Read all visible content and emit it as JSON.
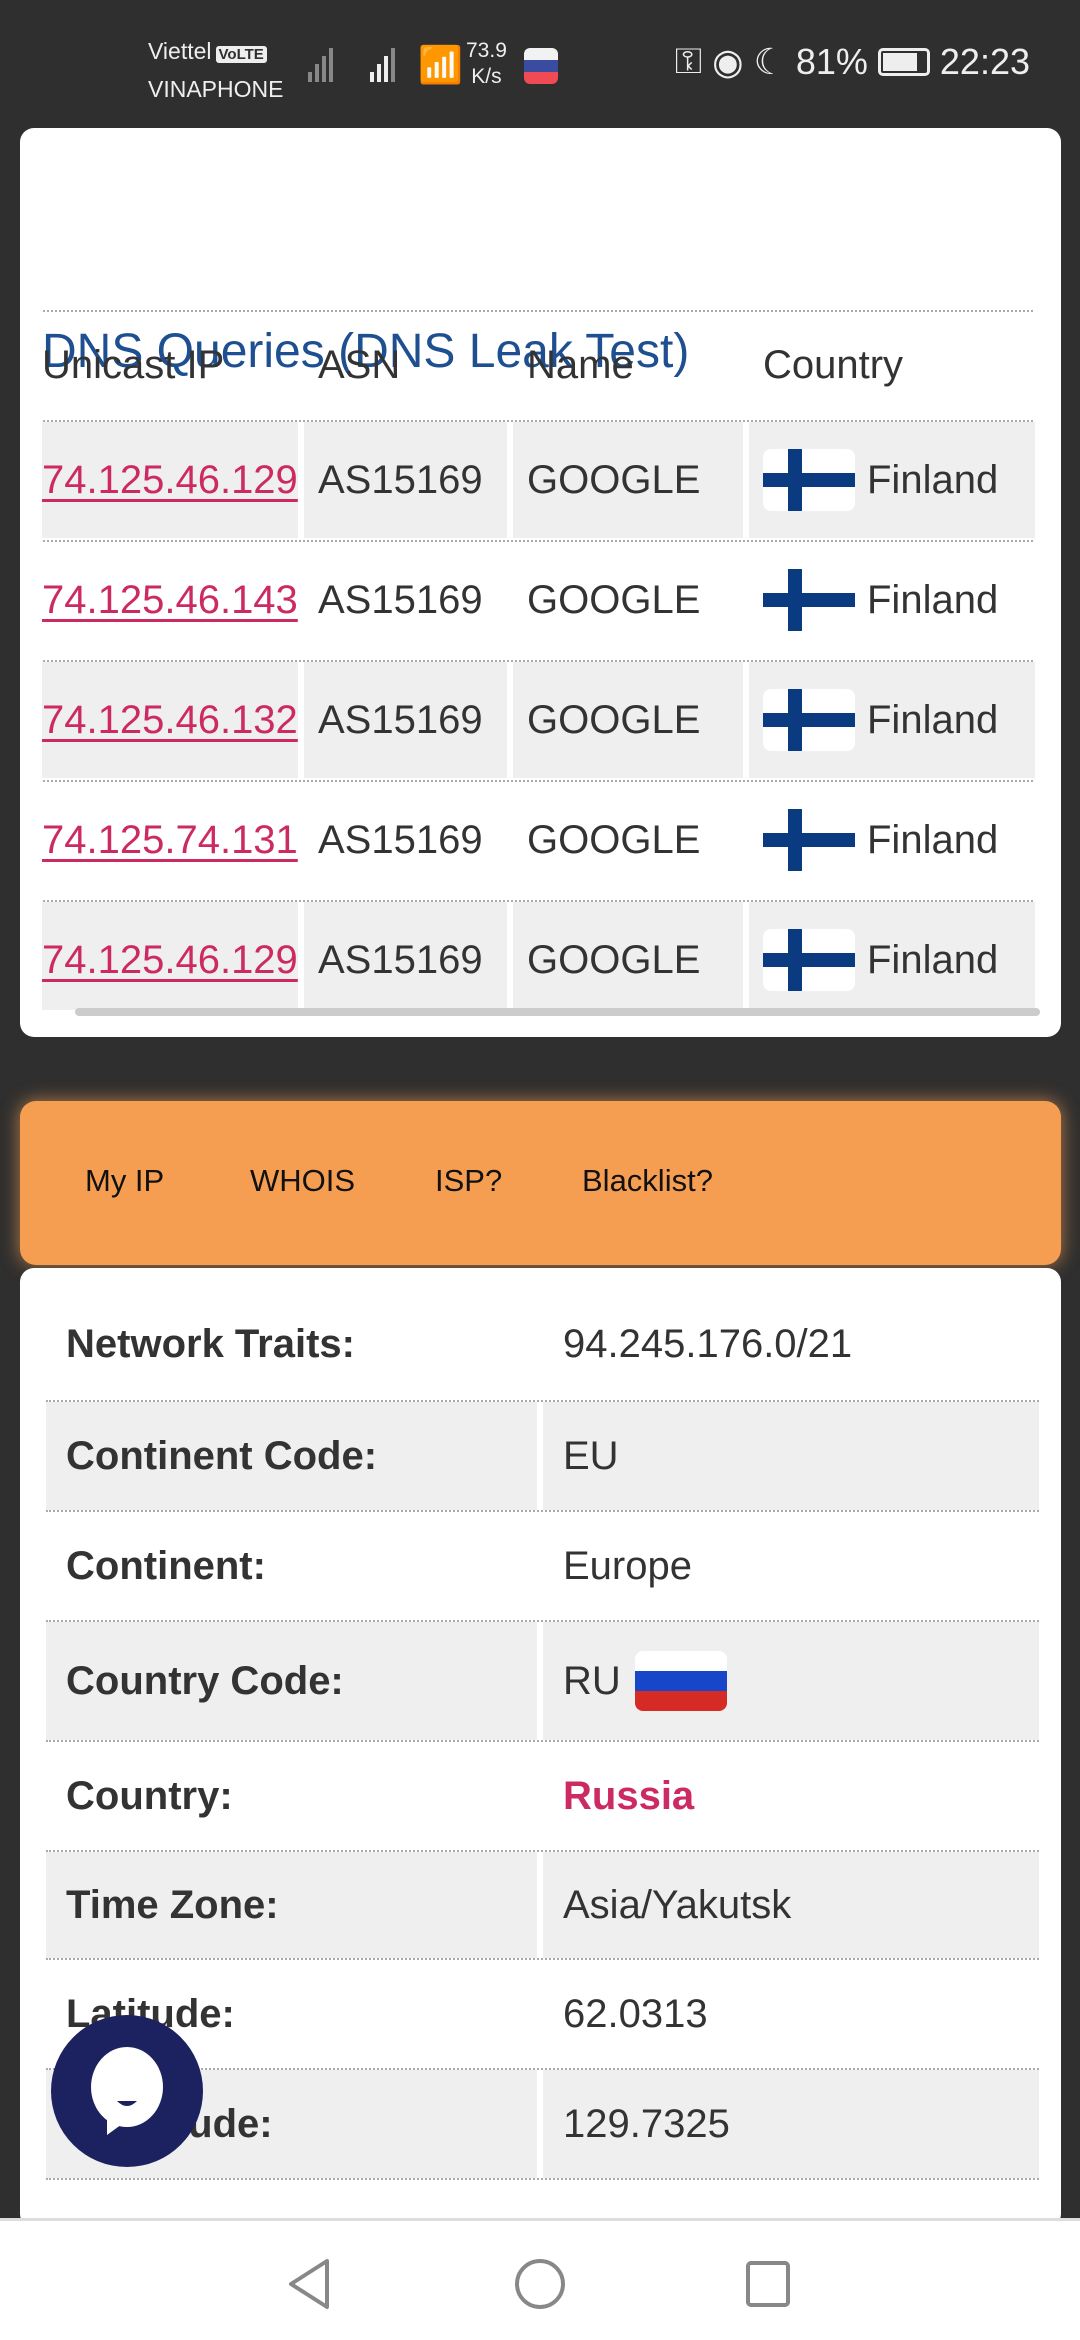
{
  "status_bar": {
    "carrier1": "Viettel",
    "volte": "VoLTE",
    "carrier2": "VINAPHONE",
    "speed_value": "73.9",
    "speed_unit": "K/s",
    "battery": "81%",
    "time": "22:23",
    "icons": [
      "signal-icon",
      "wifi-icon",
      "russia-flag-icon",
      "vpn-key-icon",
      "eye-icon",
      "moon-icon",
      "battery-icon"
    ]
  },
  "dns": {
    "title": "DNS Queries (DNS Leak Test)",
    "headers": [
      "Unicast IP",
      "ASN",
      "Name",
      "Country"
    ],
    "rows": [
      {
        "ip": "74.125.46.129",
        "asn": "AS15169",
        "name": "GOOGLE",
        "country": "Finland"
      },
      {
        "ip": "74.125.46.143",
        "asn": "AS15169",
        "name": "GOOGLE",
        "country": "Finland"
      },
      {
        "ip": "74.125.46.132",
        "asn": "AS15169",
        "name": "GOOGLE",
        "country": "Finland"
      },
      {
        "ip": "74.125.74.131",
        "asn": "AS15169",
        "name": "GOOGLE",
        "country": "Finland"
      },
      {
        "ip": "74.125.46.129",
        "asn": "AS15169",
        "name": "GOOGLE",
        "country": "Finland"
      }
    ]
  },
  "nav": {
    "items": [
      "My IP",
      "WHOIS",
      "ISP?",
      "Blacklist?"
    ],
    "color": "#f59e52"
  },
  "info": {
    "rows": [
      {
        "label": "Network Traits:",
        "value": "94.245.176.0/21"
      },
      {
        "label": "Continent Code:",
        "value": "EU"
      },
      {
        "label": "Continent:",
        "value": "Europe"
      },
      {
        "label": "Country Code:",
        "value": "RU"
      },
      {
        "label": "Country:",
        "value": "Russia"
      },
      {
        "label": "Time Zone:",
        "value": "Asia/Yakutsk"
      },
      {
        "label": "Latitude:",
        "value": "62.0313"
      },
      {
        "label": "Longitude:",
        "value": "129.7325"
      }
    ]
  },
  "colors": {
    "link": "#cc2a63",
    "title": "#1d4f91",
    "chat": "#1c2260"
  }
}
